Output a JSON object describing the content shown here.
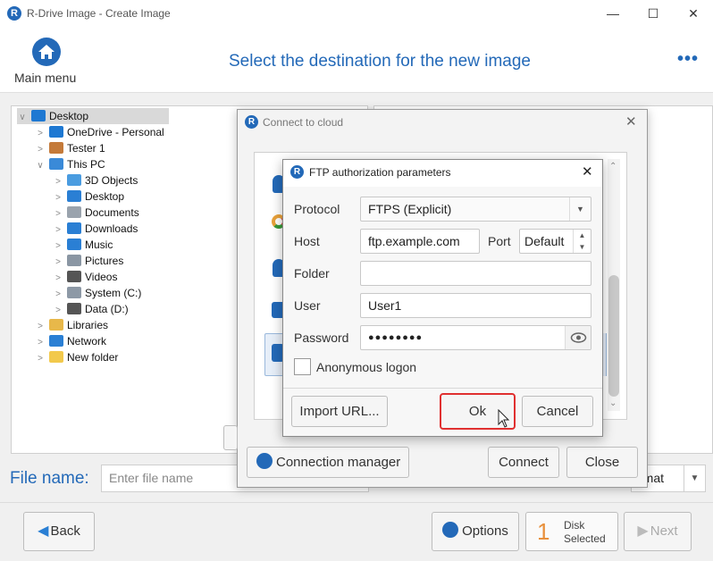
{
  "app": {
    "title": "R-Drive Image - Create Image",
    "logo_letter": "R"
  },
  "window_controls": {
    "minimize": "—",
    "maximize": "☐",
    "close": "✕"
  },
  "header": {
    "main_menu_label": "Main menu",
    "page_title": "Select the destination for the new image",
    "more": "•••"
  },
  "tree": {
    "items": [
      {
        "label": "Desktop",
        "arrow": "∨",
        "icon": "desktop-icon",
        "color": "#1e78d2"
      },
      {
        "label": "OneDrive - Personal",
        "arrow": ">",
        "icon": "cloud-icon",
        "color": "#1e78d2"
      },
      {
        "label": "Tester 1",
        "arrow": ">",
        "icon": "user-icon",
        "color": "#c47a3a"
      },
      {
        "label": "This PC",
        "arrow": "∨",
        "icon": "computer-icon",
        "color": "#3a8ad8"
      },
      {
        "label": "3D Objects",
        "arrow": ">",
        "icon": "cube-icon",
        "color": "#4a9ce0"
      },
      {
        "label": "Desktop",
        "arrow": ">",
        "icon": "desktop-icon",
        "color": "#2a7fd4"
      },
      {
        "label": "Documents",
        "arrow": ">",
        "icon": "document-icon",
        "color": "#9aa3ad"
      },
      {
        "label": "Downloads",
        "arrow": ">",
        "icon": "download-icon",
        "color": "#2a7fd4"
      },
      {
        "label": "Music",
        "arrow": ">",
        "icon": "music-icon",
        "color": "#2a7fd4"
      },
      {
        "label": "Pictures",
        "arrow": ">",
        "icon": "picture-icon",
        "color": "#8a96a3"
      },
      {
        "label": "Videos",
        "arrow": ">",
        "icon": "video-icon",
        "color": "#555555"
      },
      {
        "label": "System (C:)",
        "arrow": ">",
        "icon": "drive-icon",
        "color": "#8d99a6"
      },
      {
        "label": "Data (D:)",
        "arrow": ">",
        "icon": "drive-icon",
        "color": "#555555"
      },
      {
        "label": "Libraries",
        "arrow": ">",
        "icon": "library-icon",
        "color": "#e8b84a"
      },
      {
        "label": "Network",
        "arrow": ">",
        "icon": "network-icon",
        "color": "#2a7fd4"
      },
      {
        "label": "New folder",
        "arrow": ">",
        "icon": "folder-icon",
        "color": "#f2c94c"
      }
    ]
  },
  "file_name": {
    "label": "File name:",
    "placeholder": "Enter file name",
    "format_value": "rmat"
  },
  "bottom": {
    "back": "Back",
    "options": "Options",
    "disk_count": "1",
    "disk_label_1": "Disk",
    "disk_label_2": "Selected",
    "next": "Next"
  },
  "cloud_dialog": {
    "title": "Connect to cloud",
    "connection_manager": "Connection manager",
    "connect": "Connect",
    "close": "Close"
  },
  "ftp_dialog": {
    "title": "FTP authorization parameters",
    "protocol_label": "Protocol",
    "protocol_value": "FTPS (Explicit)",
    "host_label": "Host",
    "host_value": "ftp.example.com",
    "port_label": "Port",
    "port_value": "Default",
    "folder_label": "Folder",
    "folder_value": "",
    "user_label": "User",
    "user_value": "User1",
    "password_label": "Password",
    "password_value": "●●●●●●●●",
    "anonymous_label": "Anonymous logon",
    "anonymous_checked": false,
    "import_url": "Import URL...",
    "ok": "Ok",
    "cancel": "Cancel"
  },
  "colors": {
    "accent": "#2369b8",
    "focus_border": "#e03030"
  }
}
